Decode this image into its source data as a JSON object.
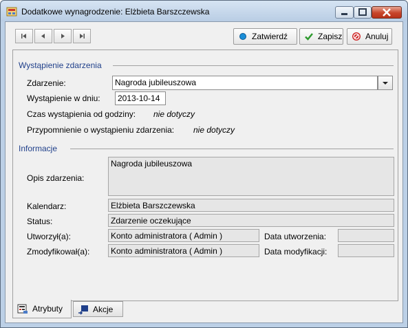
{
  "window": {
    "title": "Dodatkowe wynagrodzenie: Elżbieta Barszczewska"
  },
  "toolbar": {
    "confirm_label": "Zatwierdź",
    "save_label": "Zapisz",
    "cancel_label": "Anuluj"
  },
  "event_section": {
    "heading": "Wystąpienie zdarzenia",
    "event_label": "Zdarzenie:",
    "event_value": "Nagroda jubileuszowa",
    "date_label": "Wystąpienie w dniu:",
    "date_value": "2013-10-14",
    "time_label": "Czas wystąpienia od godziny:",
    "time_value": "nie dotyczy",
    "reminder_label": "Przypomnienie o wystąpieniu zdarzenia:",
    "reminder_value": "nie dotyczy"
  },
  "info_section": {
    "heading": "Informacje",
    "description_label": "Opis zdarzenia:",
    "description_value": "Nagroda jubileuszowa",
    "calendar_label": "Kalendarz:",
    "calendar_value": "Elżbieta Barszczewska",
    "status_label": "Status:",
    "status_value": "Zdarzenie oczekujące",
    "created_by_label": "Utworzył(a):",
    "created_by_value": "Konto administratora ( Admin )",
    "created_date_label": "Data utworzenia:",
    "created_date_value": "",
    "modified_by_label": "Zmodyfikował(a):",
    "modified_by_value": "Konto administratora ( Admin )",
    "modified_date_label": "Data modyfikacji:",
    "modified_date_value": ""
  },
  "tabs": [
    {
      "label": "Atrybuty",
      "active": true
    },
    {
      "label": "Akcje",
      "active": false
    }
  ],
  "icons": {
    "app": "window-app-icon",
    "first": "first-record-icon",
    "prev": "previous-record-icon",
    "next": "next-record-icon",
    "last": "last-record-icon",
    "confirm": "blue-dot-icon",
    "save": "green-check-icon",
    "cancel": "red-no-icon"
  },
  "colors": {
    "section_heading": "#1f3f8a",
    "close_button": "#c7452a",
    "save_check": "#2e9a2e",
    "cancel_icon": "#d02b2b",
    "confirm_dot": "#1b8ed8"
  }
}
